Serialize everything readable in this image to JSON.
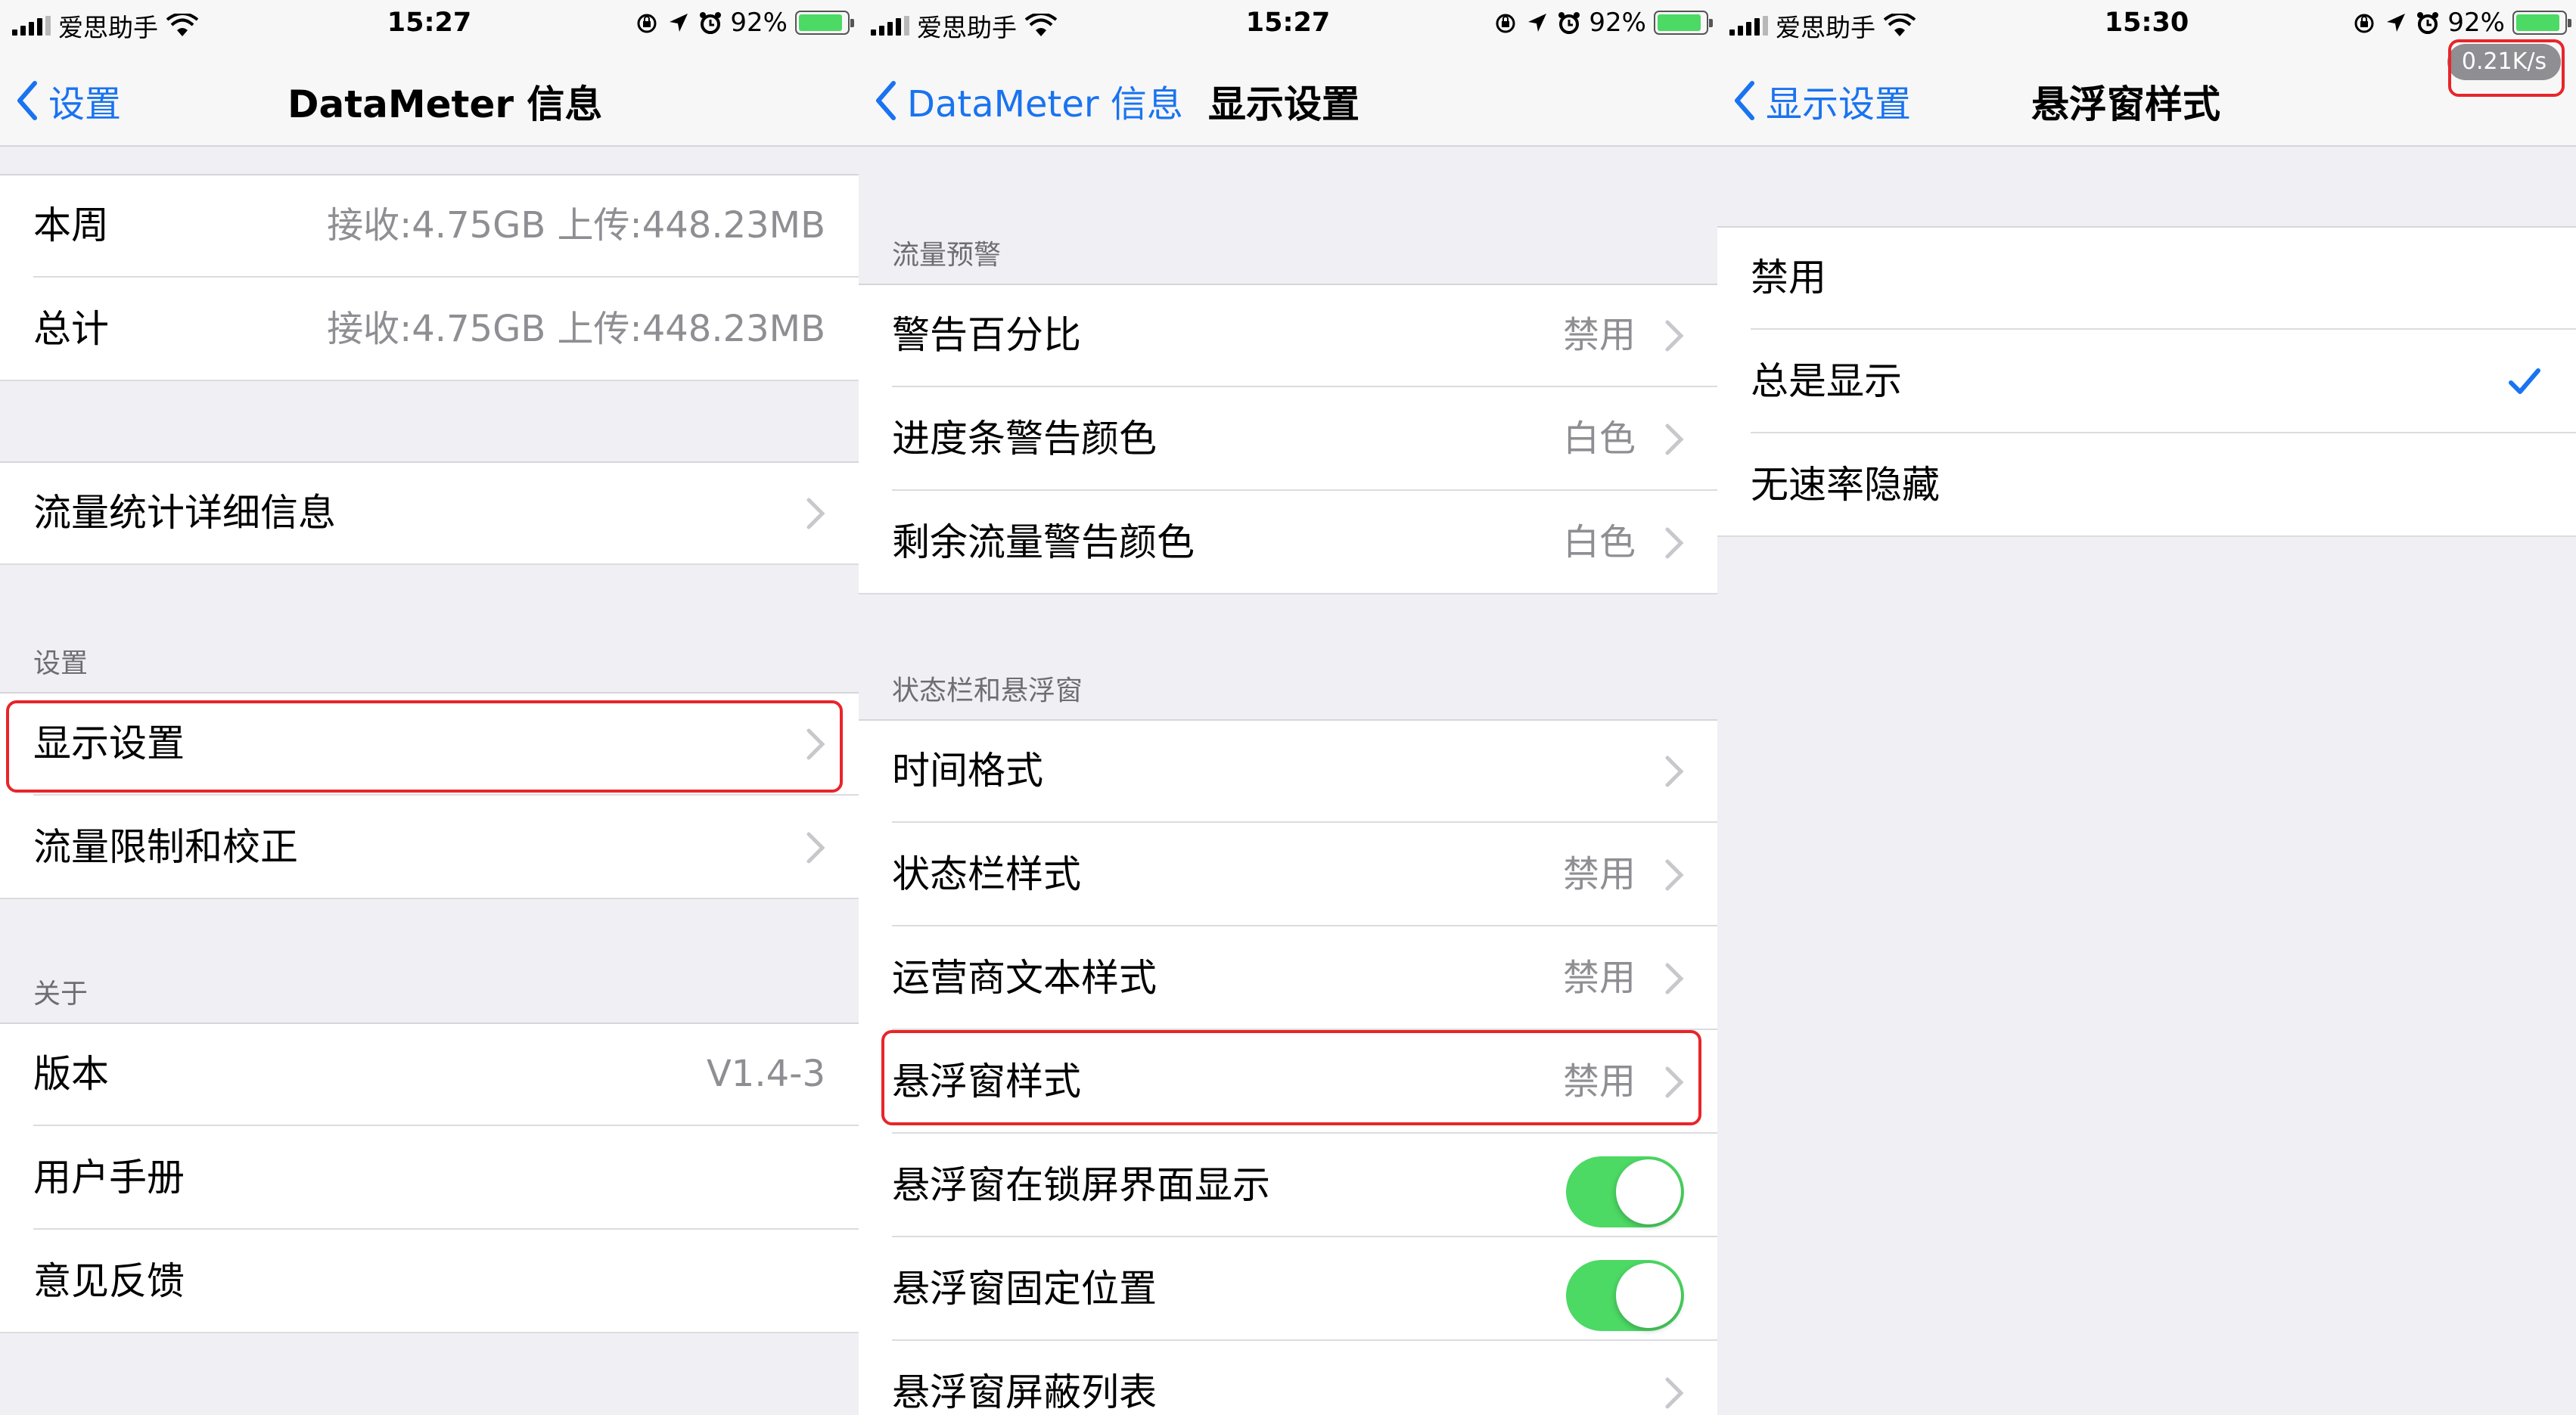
{
  "screens": [
    {
      "status": {
        "carrier": "爱思助手",
        "time": "15:27",
        "battery_pct": "92%",
        "battery_level": 0.92
      },
      "nav": {
        "back": "设置",
        "title": "DataMeter 信息"
      },
      "sections": {
        "usage": {
          "rows": [
            {
              "label": "本周",
              "value": "接收:4.75GB 上传:448.23MB"
            },
            {
              "label": "总计",
              "value": "接收:4.75GB 上传:448.23MB"
            }
          ]
        },
        "details": {
          "rows": [
            {
              "label": "流量统计详细信息"
            }
          ]
        },
        "settings": {
          "header": "设置",
          "rows": [
            {
              "label": "显示设置"
            },
            {
              "label": "流量限制和校正"
            }
          ]
        },
        "about": {
          "header": "关于",
          "rows": [
            {
              "label": "版本",
              "value": "V1.4-3"
            },
            {
              "label": "用户手册"
            },
            {
              "label": "意见反馈"
            }
          ]
        }
      }
    },
    {
      "status": {
        "carrier": "爱思助手",
        "time": "15:27",
        "battery_pct": "92%",
        "battery_level": 0.92
      },
      "nav": {
        "back": "DataMeter 信息",
        "title": "显示设置"
      },
      "sections": {
        "warning": {
          "header": "流量预警",
          "rows": [
            {
              "label": "警告百分比",
              "value": "禁用"
            },
            {
              "label": "进度条警告颜色",
              "value": "白色"
            },
            {
              "label": "剩余流量警告颜色",
              "value": "白色"
            }
          ]
        },
        "statusbar": {
          "header": "状态栏和悬浮窗",
          "rows": [
            {
              "label": "时间格式"
            },
            {
              "label": "状态栏样式",
              "value": "禁用"
            },
            {
              "label": "运营商文本样式",
              "value": "禁用"
            },
            {
              "label": "悬浮窗样式",
              "value": "禁用"
            },
            {
              "label": "悬浮窗在锁屏界面显示",
              "toggle": true
            },
            {
              "label": "悬浮窗固定位置",
              "toggle": true
            },
            {
              "label": "悬浮窗屏蔽列表"
            }
          ]
        }
      }
    },
    {
      "status": {
        "carrier": "爱思助手",
        "time": "15:30",
        "battery_pct": "92%",
        "battery_level": 0.92
      },
      "nav": {
        "back": "显示设置",
        "title": "悬浮窗样式"
      },
      "speed": "0.21K/s",
      "options": [
        {
          "label": "禁用",
          "selected": false
        },
        {
          "label": "总是显示",
          "selected": true
        },
        {
          "label": "无速率隐藏",
          "selected": false
        }
      ]
    }
  ],
  "colors": {
    "accent": "#1a73f0",
    "highlight": "#e8252a",
    "toggle_on": "#4cd964",
    "battery": "#4cd964"
  },
  "icons": [
    "cellular-signal-icon",
    "wifi-icon",
    "orientation-lock-icon",
    "location-arrow-icon",
    "alarm-icon",
    "battery-icon",
    "charging-bolt-icon",
    "back-chevron-icon",
    "chevron-right-icon",
    "checkmark-icon"
  ]
}
